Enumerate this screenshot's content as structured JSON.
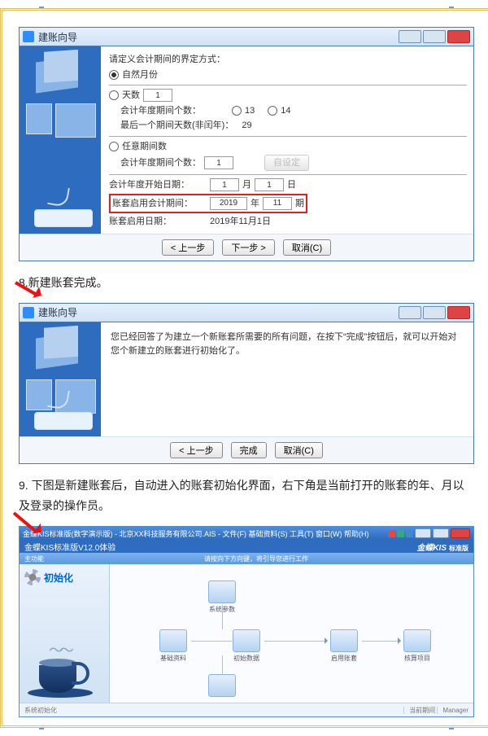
{
  "dialog1": {
    "title": "建账向导",
    "heading": "请定义会计期间的界定方式：",
    "optNatural": "自然月份",
    "optDays": "天数",
    "daysValue": "1",
    "periodsLabel": "会计年度期间个数：",
    "opt13": "13",
    "opt14": "14",
    "lastPeriodDays": "最后一个期间天数(非闰年)：",
    "lastPeriodDaysVal": "29",
    "optAnyPeriods": "任意期间数",
    "anyPeriodsLabel": "会计年度期间个数：",
    "anyPeriodsVal": "1",
    "setupBtn": "自设定",
    "startDateLabel": "会计年度开始日期：",
    "startMonth": "1",
    "startMonthUnit": "月",
    "startDay": "1",
    "startDayUnit": "日",
    "enablePeriodLabel": "账套启用会计期间：",
    "enableYear": "2019",
    "enableYearUnit": "年",
    "enablePeriod": "11",
    "enablePeriodUnit": "期",
    "enableDateLabel": "账套启用日期：",
    "enableDate": "2019年11月1日",
    "btnPrev": "< 上一步",
    "btnNext": "下一步 >",
    "btnCancel": "取消(C)"
  },
  "step8": "8.新建账套完成。",
  "dialog2": {
    "title": "建账向导",
    "msg": "您已经回答了为建立一个新账套所需要的所有问题，在按下“完成”按钮后，就可以开始对您个新建立的账套进行初始化了。",
    "btnPrev": "< 上一步",
    "btnFinish": "完成",
    "btnCancel": "取消(C)"
  },
  "step9": "9. 下图是新建账套后，自动进入的账套初始化界面，右下角是当前打开的账套的年、月以及登录的操作员。",
  "app": {
    "titlebar": "金蝶KIS标准版(数字演示版) - 北京XX科技服务有限公司.AIS - 文件(F)  基础资料(S)  工具(T)  窗口(W)  帮助(H)",
    "subLeft": "金蝶KIS标准版V12.0体验",
    "brand": "金蝶KIS",
    "brandStd": "标准版",
    "hintLeft": "主功能",
    "hintMid": "请按向下方向键，将引导您进行工作",
    "sideTitle": "初始化",
    "flow": {
      "param": "系统参数",
      "base": "基础资料",
      "init": "初始数据",
      "enable": "启用账套",
      "sched": "核算项目"
    },
    "status": {
      "left": "系统初始化",
      "period": "当前期间",
      "user": "Manager"
    }
  }
}
